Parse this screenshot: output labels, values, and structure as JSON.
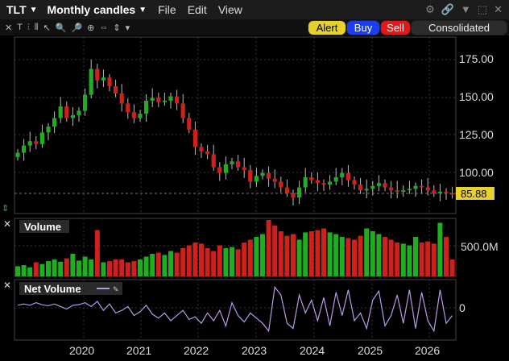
{
  "header": {
    "symbol": "TLT",
    "period": "Monthly candles",
    "menus": [
      "File",
      "Edit",
      "View"
    ]
  },
  "buttons": {
    "alert": "Alert",
    "buy": "Buy",
    "sell": "Sell",
    "consolidated": "Consolidated"
  },
  "price_panel": {
    "last": "85.88",
    "y_ticks": [
      "175.00",
      "150.00",
      "125.00",
      "100.00"
    ]
  },
  "volume_panel": {
    "title": "Volume",
    "y_tick": "500.0M"
  },
  "net_volume_panel": {
    "title": "Net Volume",
    "y_tick": "0"
  },
  "x_ticks": [
    "2020",
    "2021",
    "2022",
    "2023",
    "2024",
    "2025",
    "2026"
  ],
  "colors": {
    "up": "#1fae1f",
    "down": "#d0201b",
    "net": "#b79be8",
    "label": "#e6d22a"
  },
  "chart_data": {
    "type": "candlestick",
    "close": [
      114,
      119,
      122,
      120,
      128,
      132,
      138,
      146,
      138,
      140,
      143,
      154,
      172,
      164,
      166,
      160,
      155,
      148,
      142,
      138,
      141,
      150,
      152,
      149,
      150,
      153,
      148,
      138,
      130,
      118,
      115,
      113,
      104,
      100,
      106,
      108,
      104,
      102,
      94,
      98,
      100,
      96,
      94,
      90,
      86,
      83,
      90,
      97,
      95,
      93,
      92,
      94,
      97,
      100,
      95,
      92,
      88,
      89,
      91,
      93,
      90,
      88,
      87,
      88,
      89,
      91,
      90,
      88,
      86,
      87,
      86,
      85.88
    ],
    "volume": [
      0.18,
      0.2,
      0.16,
      0.25,
      0.22,
      0.27,
      0.3,
      0.26,
      0.32,
      0.4,
      0.28,
      0.35,
      0.3,
      0.82,
      0.25,
      0.27,
      0.3,
      0.3,
      0.25,
      0.27,
      0.3,
      0.35,
      0.4,
      0.42,
      0.38,
      0.45,
      0.42,
      0.5,
      0.55,
      0.6,
      0.58,
      0.5,
      0.45,
      0.55,
      0.5,
      0.52,
      0.48,
      0.6,
      0.65,
      0.7,
      0.75,
      1.0,
      0.9,
      0.8,
      0.72,
      0.75,
      0.65,
      0.78,
      0.8,
      0.82,
      0.85,
      0.78,
      0.75,
      0.7,
      0.68,
      0.65,
      0.72,
      0.85,
      0.8,
      0.75,
      0.7,
      0.65,
      0.6,
      0.58,
      0.55,
      0.7,
      0.6,
      0.62,
      0.58,
      0.95,
      0.7,
      0.3
    ],
    "net": [
      0.1,
      0.15,
      0.1,
      0.2,
      0.12,
      0.08,
      0.15,
      0.05,
      -0.05,
      0.1,
      0.12,
      0.2,
      0.05,
      0.25,
      -0.1,
      0.15,
      -0.2,
      -0.1,
      0.05,
      -0.3,
      -0.15,
      0.1,
      -0.25,
      -0.4,
      -0.2,
      -0.5,
      -0.3,
      -0.1,
      -0.45,
      -0.35,
      -0.6,
      -0.2,
      -0.5,
      -0.1,
      -0.7,
      0.2,
      -0.3,
      -0.55,
      -0.2,
      -0.4,
      -0.6,
      -0.9,
      0.8,
      0.5,
      -0.6,
      -0.8,
      0.5,
      -0.2,
      0.3,
      -0.5,
      0.4,
      -0.7,
      0.6,
      -0.3,
      0.7,
      -0.5,
      -0.2,
      -0.8,
      0.3,
      0.65,
      -0.7,
      -0.3,
      0.5,
      -0.6,
      0.7,
      -0.8,
      0.6,
      -0.5,
      -0.9,
      0.7,
      -0.6,
      -0.3
    ]
  }
}
